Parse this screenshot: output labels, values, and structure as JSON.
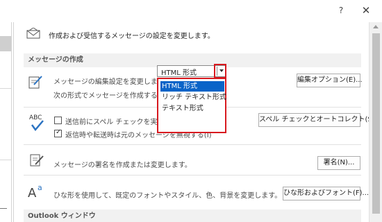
{
  "window": {
    "help_label": "?",
    "close_label": "✕"
  },
  "intro": {
    "icon": "envelope-icon",
    "text": "作成および受信するメッセージの設定を変更します。"
  },
  "compose_section": {
    "heading": "メッセージの作成",
    "edit_icon": "pencil-page-icon",
    "edit_text": "メッセージの編集設定を変更します。",
    "editor_options_button": "編集オプション(E)...",
    "format_label": "次の形式でメッセージを作成する(C):",
    "format_value": "HTML 形式",
    "format_options": [
      "HTML 形式",
      "リッチ テキスト形式",
      "テキスト形式"
    ],
    "format_selected_index": 0
  },
  "spelling": {
    "icon": "abc-check-icon",
    "always_check_label": "送信前にスペル チェックを実行する(A)",
    "always_check_checked": false,
    "ignore_original_label": "返信時や転送時は元のメッセージを無視する(I)",
    "ignore_original_checked": true,
    "spelling_button": "スペル チェックとオートコレクト(S)..."
  },
  "signatures": {
    "icon": "signature-pencil-icon",
    "text": "メッセージの署名を作成または変更します。",
    "button": "署名(N)..."
  },
  "stationery": {
    "icon": "font-aa-icon",
    "text": "ひな形を使用して、既定のフォントやスタイル、色、背景を変更します。",
    "button": "ひな形およびフォント(F)..."
  },
  "outlook_pane": {
    "heading": "Outlook ウィンドウ"
  },
  "colors": {
    "highlight_border": "#d8191f",
    "selected_bg": "#0a64c8"
  }
}
